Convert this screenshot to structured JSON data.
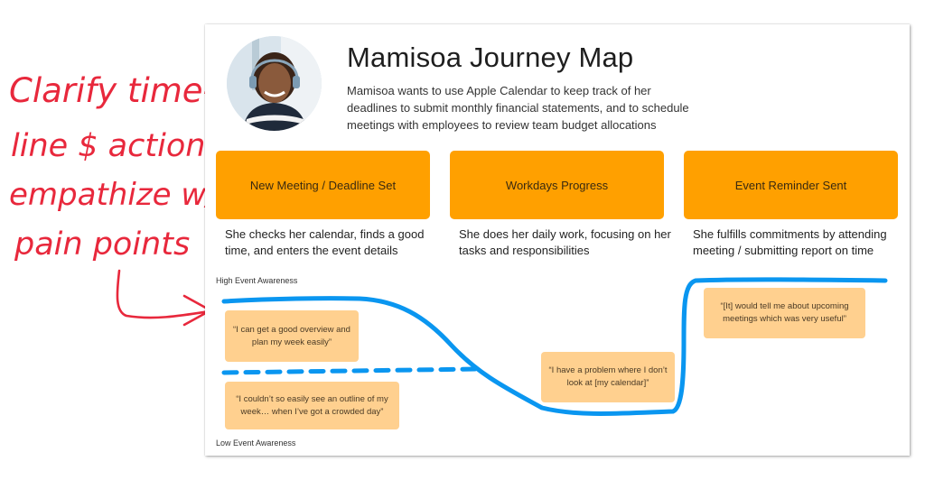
{
  "annotation": {
    "lines": [
      "Clarify time-",
      "line $ actions,",
      "empathize w/",
      "pain points"
    ],
    "color": "#e8283c"
  },
  "journey_map": {
    "title": "Mamisoa Journey Map",
    "avatar": "persona-photo",
    "description": "Mamisoa wants to use Apple Calendar to keep track of her deadlines to submit monthly financial statements, and to schedule meetings with employees to review team budget allocations",
    "stage_color": "#ffa000",
    "quote_color": "#ffd08f",
    "curve_color": "#0a96f0",
    "stages": [
      {
        "label": "New Meeting / Deadline Set",
        "description": "She checks her calendar, finds a good time, and enters the event details"
      },
      {
        "label": "Workdays Progress",
        "description": "She does her daily work, focusing on her tasks and responsibilities"
      },
      {
        "label": "Event Reminder Sent",
        "description": "She fulfills commitments by attending meeting / submitting report on time"
      }
    ],
    "axis": {
      "high": "High Event Awareness",
      "low": "Low Event Awareness"
    },
    "quotes": [
      "“I can get a good overview and plan my week easily”",
      "“I couldn’t so easily see an outline of my week… when I’ve got a crowded day”",
      "“I have a problem where I don’t look at [my calendar]”",
      "“[It] would tell me about upcoming meetings which was very useful”"
    ]
  }
}
